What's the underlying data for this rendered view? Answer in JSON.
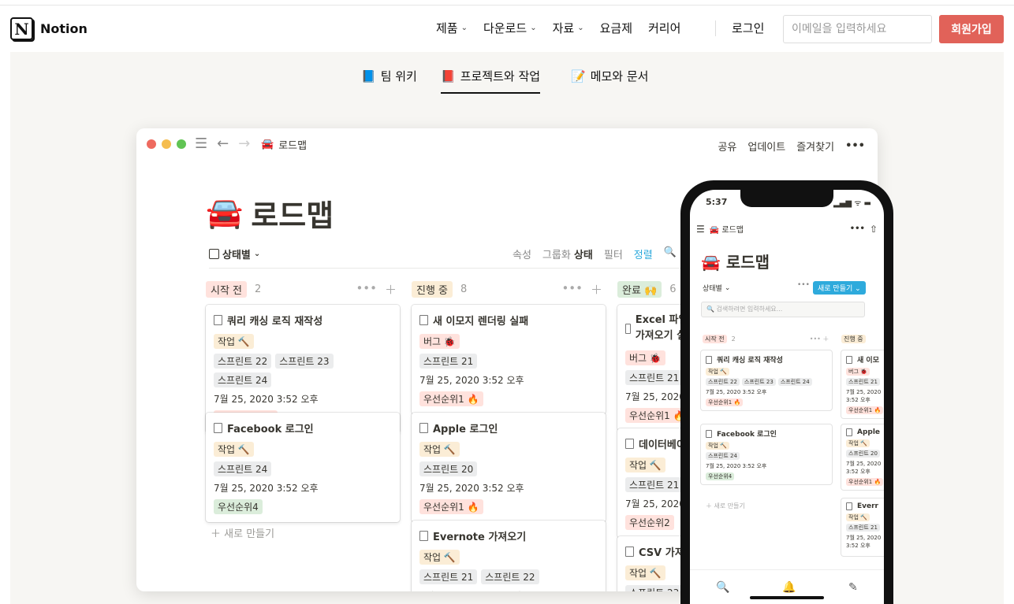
{
  "nav": {
    "logo_text": "Notion",
    "menu": [
      {
        "label": "제품",
        "caret": true
      },
      {
        "label": "다운로드",
        "caret": true
      },
      {
        "label": "자료",
        "caret": true
      },
      {
        "label": "요금제",
        "caret": false
      },
      {
        "label": "커리어",
        "caret": false
      }
    ],
    "login": "로그인",
    "email_placeholder": "이메일을 입력하세요",
    "signup": "회원가입"
  },
  "tabs": [
    {
      "icon": "📘",
      "label": "팀 위키",
      "active": false
    },
    {
      "icon": "📕",
      "label": "프로젝트와 작업",
      "active": true
    },
    {
      "icon": "📝",
      "label": "메모와 문서",
      "active": false
    }
  ],
  "window": {
    "breadcrumb_icon": "🚘",
    "breadcrumb": "로드맵",
    "actions": [
      "공유",
      "업데이트",
      "즐겨찾기",
      "•••"
    ],
    "title_icon": "🚘",
    "title": "로드맵",
    "view": "상태별",
    "toolbar": {
      "props": "속성",
      "group": "그룹화",
      "group_value": "상태",
      "filter": "필터",
      "sort": "정렬"
    },
    "new_label": "새로 만들기"
  },
  "columns": [
    {
      "label": "시작 전",
      "count": "2",
      "color": "#ffe2dd",
      "cards": [
        {
          "title": "쿼리 캐싱 로직 재작성",
          "type": "작업 🔨",
          "type_kind": "work",
          "sprints": [
            "스프린트 22",
            "스프린트 23",
            "스프린트 24"
          ],
          "date": "7월 25, 2020 3:52 오후",
          "priority": "우선순위1 🔥",
          "prio_kind": "prio"
        },
        {
          "title": "Facebook 로그인",
          "type": "작업 🔨",
          "type_kind": "work",
          "sprints": [
            "스프린트 24"
          ],
          "date": "7월 25, 2020 3:52 오후",
          "priority": "우선순위4",
          "prio_kind": "prio4"
        }
      ]
    },
    {
      "label": "진행 중",
      "count": "8",
      "color": "#fbedd6",
      "cards": [
        {
          "title": "새 이모지 렌더링 실패",
          "type": "버그 🐞",
          "type_kind": "bug",
          "sprints": [
            "스프린트 21"
          ],
          "date": "7월 25, 2020 3:52 오후",
          "priority": "우선순위1 🔥",
          "prio_kind": "prio"
        },
        {
          "title": "Apple 로그인",
          "type": "작업 🔨",
          "type_kind": "work",
          "sprints": [
            "스프린트 20"
          ],
          "date": "7월 25, 2020 3:52 오후",
          "priority": "우선순위1 🔥",
          "prio_kind": "prio"
        },
        {
          "title": "Evernote 가져오기",
          "type": "작업 🔨",
          "type_kind": "work",
          "sprints": [
            "스프린트 21",
            "스프린트 22"
          ],
          "date": "7월 25, 2020 3:52 오후",
          "priority": "",
          "prio_kind": "prio"
        }
      ]
    },
    {
      "label": "완료 🙌",
      "count": "6",
      "color": "#dbeddb",
      "cards": [
        {
          "title": "Excel 파일 가져오기 실패",
          "type": "버그 🐞",
          "type_kind": "bug",
          "sprints": [
            "스프린트 21"
          ],
          "date": "7월 25, 2020 3:52 오후",
          "priority": "우선순위1 🔥",
          "prio_kind": "prio"
        },
        {
          "title": "데이터베이스 성능",
          "type": "작업 🔨",
          "type_kind": "work",
          "sprints": [
            "스프린트 21"
          ],
          "date": "7월 25, 2020 3:52 오후",
          "priority": "우선순위2",
          "prio_kind": "prio"
        },
        {
          "title": "CSV 가져오기",
          "type": "작업 🔨",
          "type_kind": "work",
          "sprints": [
            "스프린트 23"
          ],
          "date": "",
          "priority": "",
          "prio_kind": "prio"
        }
      ]
    }
  ],
  "phone": {
    "time": "5:37",
    "status": "▂▄▆ ᯤ ▬",
    "breadcrumb": "🚘 로드맵",
    "title": "🚘 로드맵",
    "view": "상태별",
    "new_button": "새로 만들기",
    "search_placeholder": "검색하려면 입력하세요...",
    "col1": "시작 전",
    "col1_count": "2",
    "col2": "진행 중",
    "card1_title": "쿼리 캐싱 로직 재작성",
    "card2_title": "Facebook 로그인",
    "r1_title": "새 이모",
    "r2_title": "Apple",
    "r3_title": "Everr",
    "new_label": "새로 만들기"
  }
}
